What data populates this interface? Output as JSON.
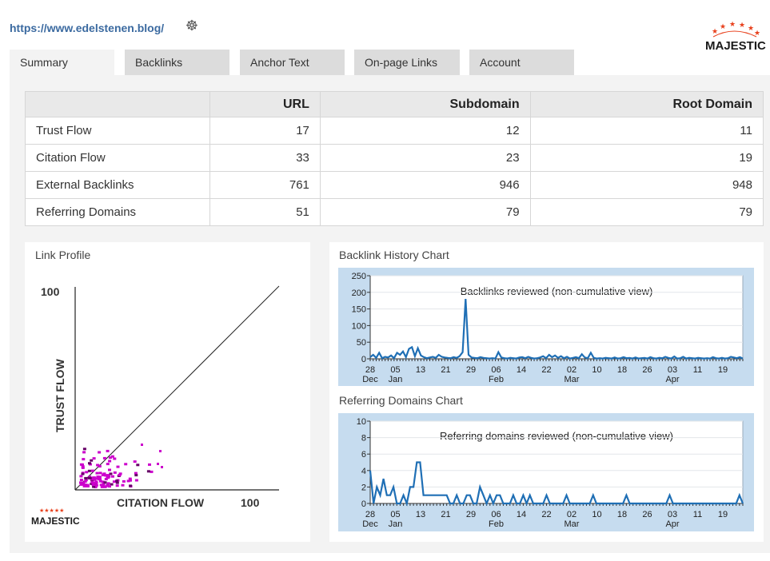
{
  "header": {
    "url": "https://www.edelstenen.blog/",
    "logo_text": "MAJESTIC"
  },
  "tabs": [
    {
      "label": "Summary",
      "active": true
    },
    {
      "label": "Backlinks",
      "active": false
    },
    {
      "label": "Anchor Text",
      "active": false
    },
    {
      "label": "On-page Links",
      "active": false
    },
    {
      "label": "Account",
      "active": false
    }
  ],
  "metrics_table": {
    "columns": [
      "",
      "URL",
      "Subdomain",
      "Root Domain"
    ],
    "rows": [
      {
        "label": "Trust Flow",
        "url": "17",
        "subdomain": "12",
        "root_domain": "11"
      },
      {
        "label": "Citation Flow",
        "url": "33",
        "subdomain": "23",
        "root_domain": "19"
      },
      {
        "label": "External Backlinks",
        "url": "761",
        "subdomain": "946",
        "root_domain": "948"
      },
      {
        "label": "Referring Domains",
        "url": "51",
        "subdomain": "79",
        "root_domain": "79"
      }
    ]
  },
  "link_profile": {
    "title": "Link Profile",
    "y_label": "TRUST FLOW",
    "x_label": "CITATION FLOW",
    "y_max_label": "100",
    "x_max_label": "100",
    "logo_text": "MAJESTIC",
    "point_color": "#cc00cc"
  },
  "backlink_history": {
    "title": "Backlink History Chart",
    "caption": "Backlinks reviewed (non-cumulative view)"
  },
  "referring_domains_chart": {
    "title": "Referring Domains Chart",
    "caption": "Referring domains reviewed (non-cumulative view)"
  },
  "chart_data": [
    {
      "type": "line",
      "name_ref": "backlink_history",
      "ylim": [
        0,
        250
      ],
      "yticks": [
        "250",
        "200",
        "150",
        "100",
        "50",
        "0"
      ],
      "x_tick_labels": [
        "28",
        "05",
        "13",
        "21",
        "29",
        "06",
        "14",
        "22",
        "02",
        "10",
        "18",
        "26",
        "03",
        "11",
        "19"
      ],
      "month_labels": [
        "Dec",
        "Jan",
        "Feb",
        "Mar",
        "Apr"
      ],
      "color": "#1f6fb5",
      "values": [
        5,
        12,
        3,
        18,
        2,
        6,
        4,
        10,
        2,
        18,
        12,
        22,
        5,
        30,
        35,
        8,
        32,
        10,
        5,
        2,
        4,
        6,
        3,
        12,
        6,
        4,
        3,
        2,
        5,
        3,
        8,
        20,
        180,
        12,
        4,
        3,
        2,
        5,
        3,
        2,
        1,
        2,
        1,
        20,
        4,
        2,
        1,
        3,
        2,
        1,
        4,
        5,
        2,
        6,
        3,
        1,
        2,
        4,
        8,
        2,
        12,
        5,
        10,
        3,
        8,
        2,
        6,
        1,
        3,
        5,
        2,
        14,
        4,
        2,
        18,
        3,
        1,
        2,
        1,
        3,
        2,
        1,
        4,
        1,
        2,
        5,
        2,
        3,
        1,
        4,
        1,
        2,
        3,
        1,
        5,
        2,
        1,
        3,
        2,
        6,
        3,
        1,
        7,
        1,
        2,
        6,
        1,
        3,
        2,
        1,
        3,
        2,
        1,
        2,
        1,
        5,
        2,
        1,
        3,
        1,
        2,
        6,
        4,
        2,
        5,
        1
      ]
    },
    {
      "type": "line",
      "name_ref": "referring_domains_chart",
      "ylim": [
        0,
        10
      ],
      "yticks": [
        "10",
        "8",
        "6",
        "4",
        "2",
        "0"
      ],
      "x_tick_labels": [
        "28",
        "05",
        "13",
        "21",
        "29",
        "06",
        "14",
        "22",
        "02",
        "10",
        "18",
        "26",
        "03",
        "11",
        "19"
      ],
      "month_labels": [
        "Dec",
        "Jan",
        "Feb",
        "Mar",
        "Apr"
      ],
      "color": "#1f6fb5",
      "values": [
        4,
        0,
        2,
        1,
        3,
        1,
        1,
        2,
        0,
        0,
        1,
        0,
        2,
        2,
        5,
        5,
        1,
        1,
        1,
        1,
        1,
        1,
        1,
        1,
        0,
        0,
        1,
        0,
        0,
        1,
        1,
        0,
        0,
        2,
        1,
        0,
        1,
        0,
        1,
        1,
        0,
        0,
        0,
        1,
        0,
        0,
        1,
        0,
        1,
        0,
        0,
        0,
        0,
        1,
        0,
        0,
        0,
        0,
        0,
        1,
        0,
        0,
        0,
        0,
        0,
        0,
        0,
        1,
        0,
        0,
        0,
        0,
        0,
        0,
        0,
        0,
        0,
        1,
        0,
        0,
        0,
        0,
        0,
        0,
        0,
        0,
        0,
        0,
        0,
        0,
        1,
        0,
        0,
        0,
        0,
        0,
        0,
        0,
        0,
        0,
        0,
        0,
        0,
        0,
        0,
        0,
        0,
        0,
        0,
        0,
        0,
        1,
        0
      ]
    }
  ]
}
